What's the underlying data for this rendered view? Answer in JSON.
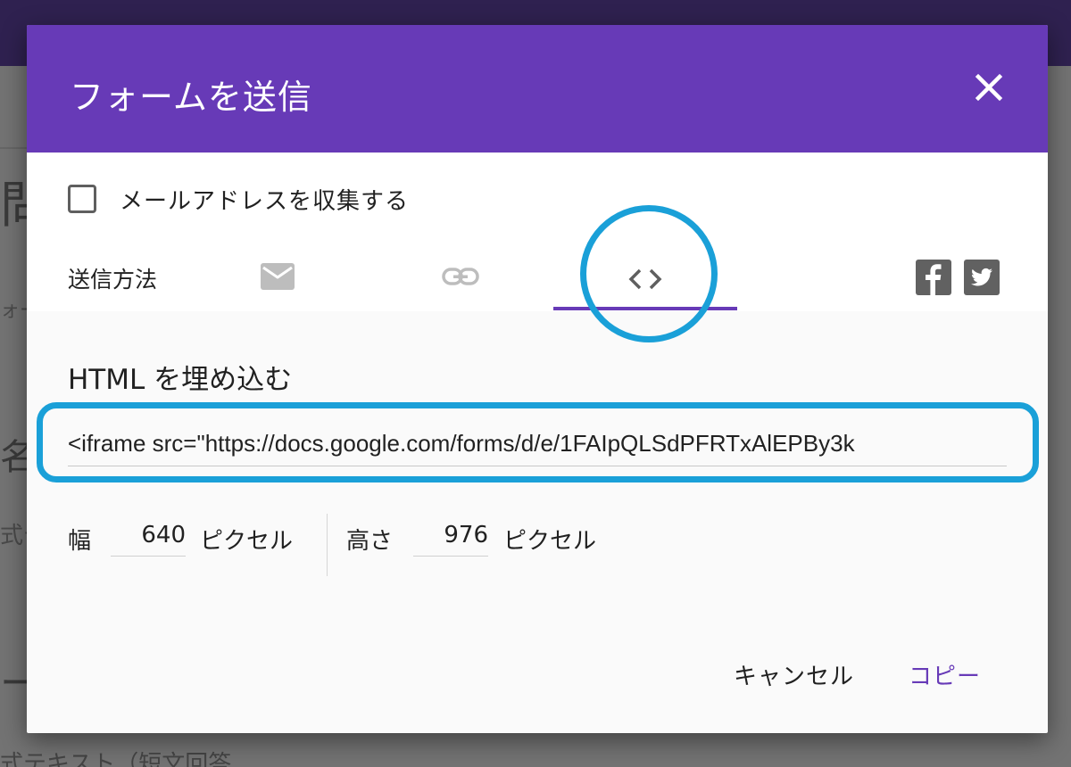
{
  "background": {
    "bits": [
      "問",
      "ォーム",
      "名前",
      "式テ",
      "ール"
    ],
    "bottom_text": "式テキスト（短文回答）"
  },
  "dialog": {
    "title": "フォームを送信",
    "collect_email_label": "メールアドレスを収集する",
    "collect_email_checked": false,
    "send_method_label": "送信方法",
    "methods": [
      {
        "name": "email",
        "icon": "mail-icon"
      },
      {
        "name": "link",
        "icon": "link-icon"
      },
      {
        "name": "embed",
        "icon": "code-icon",
        "selected": true
      }
    ],
    "social": [
      {
        "name": "facebook",
        "icon": "facebook-icon"
      },
      {
        "name": "twitter",
        "icon": "twitter-icon"
      }
    ],
    "embed": {
      "title": "HTML を埋め込む",
      "code": "<iframe src=\"https://docs.google.com/forms/d/e/1FAIpQLSdPFRTxAlEPBy3k",
      "width_label": "幅",
      "width_value": "640",
      "width_unit": "ピクセル",
      "height_label": "高さ",
      "height_value": "976",
      "height_unit": "ピクセル"
    },
    "buttons": {
      "cancel": "キャンセル",
      "copy": "コピー"
    }
  },
  "colors": {
    "header": "#673ab7",
    "accent": "#673ab7",
    "highlight": "#1aa0d8"
  }
}
